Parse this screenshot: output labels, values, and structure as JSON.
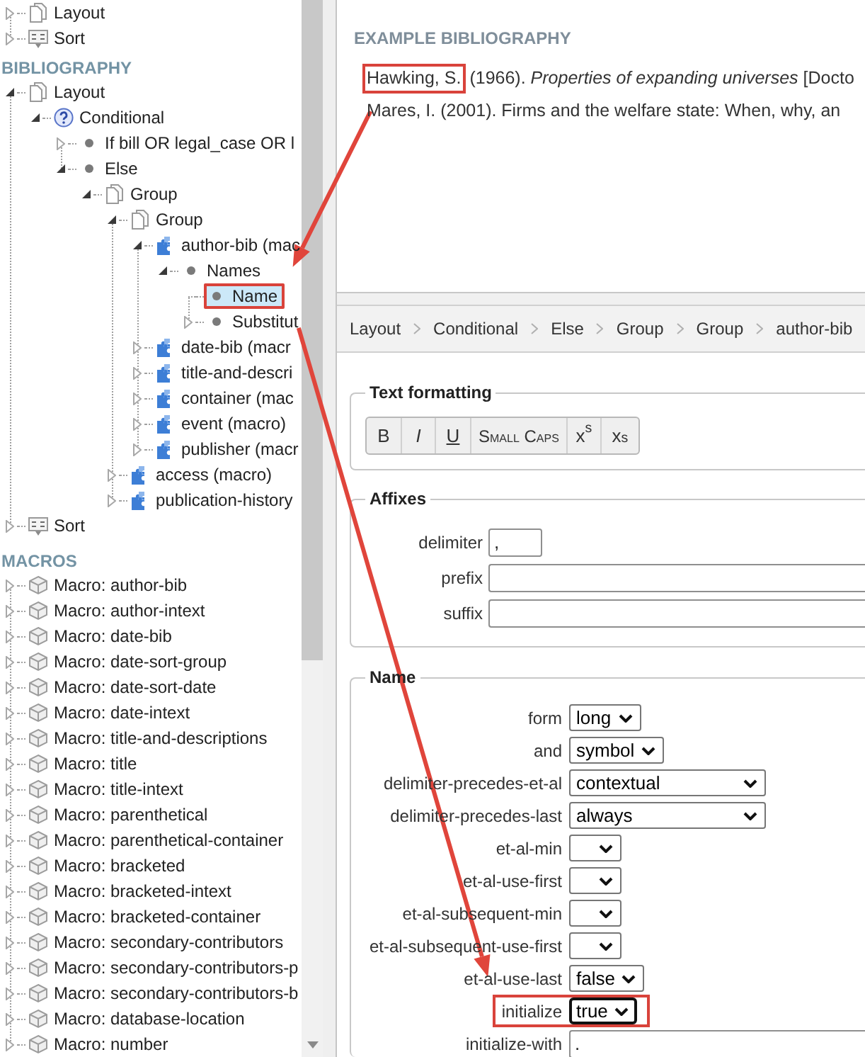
{
  "left_panel": {
    "sections": [
      {
        "items": [
          {
            "label": "Layout",
            "kind": "layout",
            "expanded": false,
            "selected": false,
            "highlighted": false
          },
          {
            "label": "Sort",
            "kind": "sort",
            "expanded": false,
            "selected": false,
            "highlighted": false
          }
        ]
      },
      {
        "title": "BIBLIOGRAPHY",
        "items": [
          {
            "label": "Layout",
            "kind": "layout",
            "expanded": true,
            "selected": false,
            "highlighted": false,
            "children": [
              {
                "label": "Conditional",
                "kind": "conditional",
                "expanded": true,
                "selected": false,
                "highlighted": false,
                "children": [
                  {
                    "label": "If bill OR legal_case OR l",
                    "kind": "element",
                    "expanded": false,
                    "selected": false,
                    "highlighted": false
                  },
                  {
                    "label": "Else",
                    "kind": "element",
                    "expanded": true,
                    "selected": false,
                    "highlighted": false,
                    "children": [
                      {
                        "label": "Group",
                        "kind": "group",
                        "expanded": true,
                        "selected": false,
                        "highlighted": false,
                        "children": [
                          {
                            "label": "Group",
                            "kind": "group",
                            "expanded": true,
                            "selected": false,
                            "highlighted": false,
                            "children": [
                              {
                                "label": "author-bib (mac",
                                "kind": "macro",
                                "expanded": true,
                                "selected": false,
                                "highlighted": false,
                                "children": [
                                  {
                                    "label": "Names",
                                    "kind": "element",
                                    "expanded": true,
                                    "selected": false,
                                    "highlighted": false,
                                    "children": [
                                      {
                                        "label": "Name",
                                        "kind": "element",
                                        "selected": true,
                                        "highlighted": true
                                      },
                                      {
                                        "label": "Substitut",
                                        "kind": "element",
                                        "expanded": false,
                                        "selected": false,
                                        "highlighted": false
                                      }
                                    ]
                                  }
                                ]
                              },
                              {
                                "label": "date-bib (macr",
                                "kind": "macro",
                                "expanded": false,
                                "selected": false,
                                "highlighted": false
                              },
                              {
                                "label": "title-and-descri",
                                "kind": "macro",
                                "expanded": false,
                                "selected": false,
                                "highlighted": false
                              },
                              {
                                "label": "container (mac",
                                "kind": "macro",
                                "expanded": false,
                                "selected": false,
                                "highlighted": false
                              },
                              {
                                "label": "event (macro)",
                                "kind": "macro",
                                "expanded": false,
                                "selected": false,
                                "highlighted": false
                              },
                              {
                                "label": "publisher (macr",
                                "kind": "macro",
                                "expanded": false,
                                "selected": false,
                                "highlighted": false
                              }
                            ]
                          },
                          {
                            "label": "access (macro)",
                            "kind": "macro",
                            "expanded": false,
                            "selected": false,
                            "highlighted": false
                          },
                          {
                            "label": "publication-history",
                            "kind": "macro",
                            "expanded": false,
                            "selected": false,
                            "highlighted": false
                          }
                        ]
                      }
                    ]
                  }
                ]
              }
            ]
          },
          {
            "label": "Sort",
            "kind": "sort",
            "expanded": false,
            "selected": false,
            "highlighted": false
          }
        ]
      },
      {
        "title": "MACROS",
        "items": [
          {
            "label": "Macro: author-bib",
            "kind": "macro_definition",
            "expanded": false,
            "selected": false,
            "highlighted": false
          },
          {
            "label": "Macro: author-intext",
            "kind": "macro_definition",
            "expanded": false,
            "selected": false,
            "highlighted": false
          },
          {
            "label": "Macro: date-bib",
            "kind": "macro_definition",
            "expanded": false,
            "selected": false,
            "highlighted": false
          },
          {
            "label": "Macro: date-sort-group",
            "kind": "macro_definition",
            "expanded": false,
            "selected": false,
            "highlighted": false
          },
          {
            "label": "Macro: date-sort-date",
            "kind": "macro_definition",
            "expanded": false,
            "selected": false,
            "highlighted": false
          },
          {
            "label": "Macro: date-intext",
            "kind": "macro_definition",
            "expanded": false,
            "selected": false,
            "highlighted": false
          },
          {
            "label": "Macro: title-and-descriptions",
            "kind": "macro_definition",
            "expanded": false,
            "selected": false,
            "highlighted": false
          },
          {
            "label": "Macro: title",
            "kind": "macro_definition",
            "expanded": false,
            "selected": false,
            "highlighted": false
          },
          {
            "label": "Macro: title-intext",
            "kind": "macro_definition",
            "expanded": false,
            "selected": false,
            "highlighted": false
          },
          {
            "label": "Macro: parenthetical",
            "kind": "macro_definition",
            "expanded": false,
            "selected": false,
            "highlighted": false
          },
          {
            "label": "Macro: parenthetical-container",
            "kind": "macro_definition",
            "expanded": false,
            "selected": false,
            "highlighted": false
          },
          {
            "label": "Macro: bracketed",
            "kind": "macro_definition",
            "expanded": false,
            "selected": false,
            "highlighted": false
          },
          {
            "label": "Macro: bracketed-intext",
            "kind": "macro_definition",
            "expanded": false,
            "selected": false,
            "highlighted": false
          },
          {
            "label": "Macro: bracketed-container",
            "kind": "macro_definition",
            "expanded": false,
            "selected": false,
            "highlighted": false
          },
          {
            "label": "Macro: secondary-contributors",
            "kind": "macro_definition",
            "expanded": false,
            "selected": false,
            "highlighted": false
          },
          {
            "label": "Macro: secondary-contributors-p",
            "kind": "macro_definition",
            "expanded": false,
            "selected": false,
            "highlighted": false
          },
          {
            "label": "Macro: secondary-contributors-b",
            "kind": "macro_definition",
            "expanded": false,
            "selected": false,
            "highlighted": false
          },
          {
            "label": "Macro: database-location",
            "kind": "macro_definition",
            "expanded": false,
            "selected": false,
            "highlighted": false
          },
          {
            "label": "Macro: number",
            "kind": "macro_definition",
            "expanded": false,
            "selected": false,
            "highlighted": false
          }
        ]
      }
    ]
  },
  "example_bibliography": {
    "title": "EXAMPLE BIBLIOGRAPHY",
    "entries": [
      {
        "parts": [
          {
            "text": "Hawking, S.",
            "highlighted": true
          },
          {
            "text": "(1966). *Properties of expanding universes* [Docto",
            "highlighted": false
          }
        ]
      },
      {
        "parts": [
          {
            "text": "Mares, I. (2001). Firms and the welfare state: When, why, an",
            "highlighted": false
          }
        ]
      }
    ]
  },
  "breadcrumb": [
    "Layout",
    "Conditional",
    "Else",
    "Group",
    "Group",
    "author-bib"
  ],
  "text_formatting": {
    "legend": "Text formatting",
    "buttons": [
      {
        "kind": "bold",
        "label": "B"
      },
      {
        "kind": "italic",
        "label": "I"
      },
      {
        "kind": "underline",
        "label": "U"
      },
      {
        "kind": "small_caps",
        "label": "Small Caps"
      },
      {
        "kind": "superscript",
        "label": "x$^{s}$"
      },
      {
        "kind": "subscript",
        "label": "x$_{s}$"
      }
    ]
  },
  "affixes": {
    "legend": "Affixes",
    "fields": [
      {
        "label": "delimiter",
        "kind": "short_text",
        "value": ","
      },
      {
        "label": "prefix",
        "kind": "text"
      },
      {
        "label": "suffix",
        "kind": "text"
      }
    ]
  },
  "name_options": {
    "legend": "Name",
    "fields": [
      {
        "label": "form",
        "kind": "select",
        "value": "long",
        "focused": false,
        "highlighted": false
      },
      {
        "label": "and",
        "kind": "select",
        "value": "symbol",
        "focused": false,
        "highlighted": false
      },
      {
        "label": "delimiter-precedes-et-al",
        "kind": "wide_select",
        "value": "contextual",
        "focused": false,
        "highlighted": false
      },
      {
        "label": "delimiter-precedes-last",
        "kind": "wide_select",
        "value": "always",
        "focused": false,
        "highlighted": false
      },
      {
        "label": "et-al-min",
        "kind": "select",
        "focused": false,
        "highlighted": false
      },
      {
        "label": "et-al-use-first",
        "kind": "select",
        "focused": false,
        "highlighted": false
      },
      {
        "label": "et-al-subsequent-min",
        "kind": "select",
        "focused": false,
        "highlighted": false
      },
      {
        "label": "et-al-subsequent-use-first",
        "kind": "select",
        "focused": false,
        "highlighted": false
      },
      {
        "label": "et-al-use-last",
        "kind": "select",
        "value": "false",
        "focused": false,
        "highlighted": false
      },
      {
        "label": "initialize",
        "kind": "select",
        "value": "true",
        "focused": true,
        "highlighted": true
      },
      {
        "label": "initialize-with",
        "kind": "text",
        "value": ".",
        "focused": false,
        "highlighted": false
      }
    ]
  },
  "annotation_arrows": true
}
